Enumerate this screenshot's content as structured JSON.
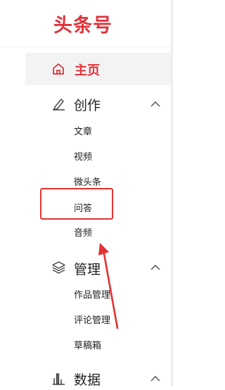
{
  "header": {
    "logo_text": "头条号"
  },
  "nav": {
    "home": {
      "label": "主页",
      "icon": "home-icon"
    },
    "groups": [
      {
        "label": "创作",
        "icon": "pen-icon",
        "items": [
          "文章",
          "视频",
          "微头条",
          "问答",
          "音频"
        ]
      },
      {
        "label": "管理",
        "icon": "layers-icon",
        "items": [
          "作品管理",
          "评论管理",
          "草稿箱"
        ]
      },
      {
        "label": "数据",
        "icon": "bar-chart-icon",
        "items": []
      }
    ]
  },
  "annotation": {
    "highlighted_item": "问答",
    "color": "#e23232"
  },
  "colors": {
    "brand": "#e0333a",
    "active_bg": "#f3f3f3"
  }
}
